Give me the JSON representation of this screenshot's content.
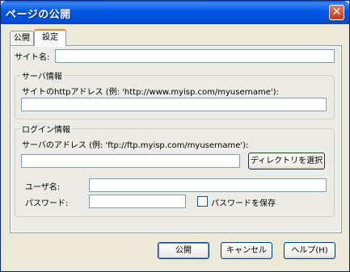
{
  "window": {
    "title": "ページの公開"
  },
  "tabs": [
    {
      "label": "公開",
      "active": false
    },
    {
      "label": "設定",
      "active": true
    }
  ],
  "site_name": {
    "label": "サイト名:",
    "value": ""
  },
  "server_info": {
    "group_title": "サーバ情報",
    "http_label": "サイトのhttpアドレス (例: 'http://www.myisp.com/myusername'):",
    "http_value": ""
  },
  "login_info": {
    "group_title": "ログイン情報",
    "server_label": "サーバのアドレス (例: 'ftp://ftp.myisp.com/myusername'):",
    "server_value": "",
    "select_dir_button": "ディレクトリを選択",
    "username_label": "ユーザ名:",
    "username_value": "",
    "password_label": "パスワード:",
    "password_value": "",
    "save_password_label": "パスワードを保存",
    "save_password_checked": false
  },
  "footer": {
    "publish_button": "公開",
    "cancel_button": "キャンセル",
    "help_button": "ヘルプ(H)"
  },
  "colors": {
    "title_bar": "#0058e6",
    "close_button": "#c0391a",
    "dialog_bg": "#ece9d8"
  },
  "icons": {
    "close": "close-icon"
  }
}
